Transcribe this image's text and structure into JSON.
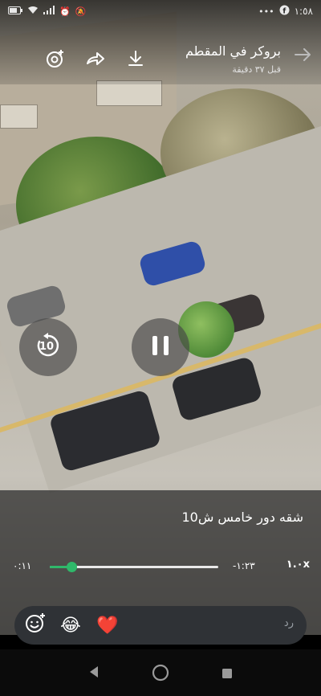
{
  "status_bar": {
    "time": "١:٥٨",
    "icons": [
      "facebook-icon",
      "dots-icon",
      "mute-icon",
      "alarm-icon",
      "signal-icon",
      "wifi-icon",
      "battery-icon"
    ]
  },
  "header": {
    "title": "بروكر في المقطم",
    "subtitle": "قبل ٣٧ دقيقة",
    "icons": [
      "back-arrow-icon",
      "download-icon",
      "forward-icon",
      "add-reaction-icon"
    ]
  },
  "player": {
    "rewind_label": "10",
    "caption": "شقه دور خامس ش10",
    "elapsed": "٠:١١",
    "remaining": "-١:٢٣",
    "progress": 0.13,
    "speed": "١.٠x"
  },
  "reply_bar": {
    "placeholder": "رد",
    "emojis": [
      "😂",
      "❤️"
    ]
  },
  "colors": {
    "accent": "#2fb86a",
    "reply_bg": "#2f3236",
    "heart": "#e8313b"
  }
}
